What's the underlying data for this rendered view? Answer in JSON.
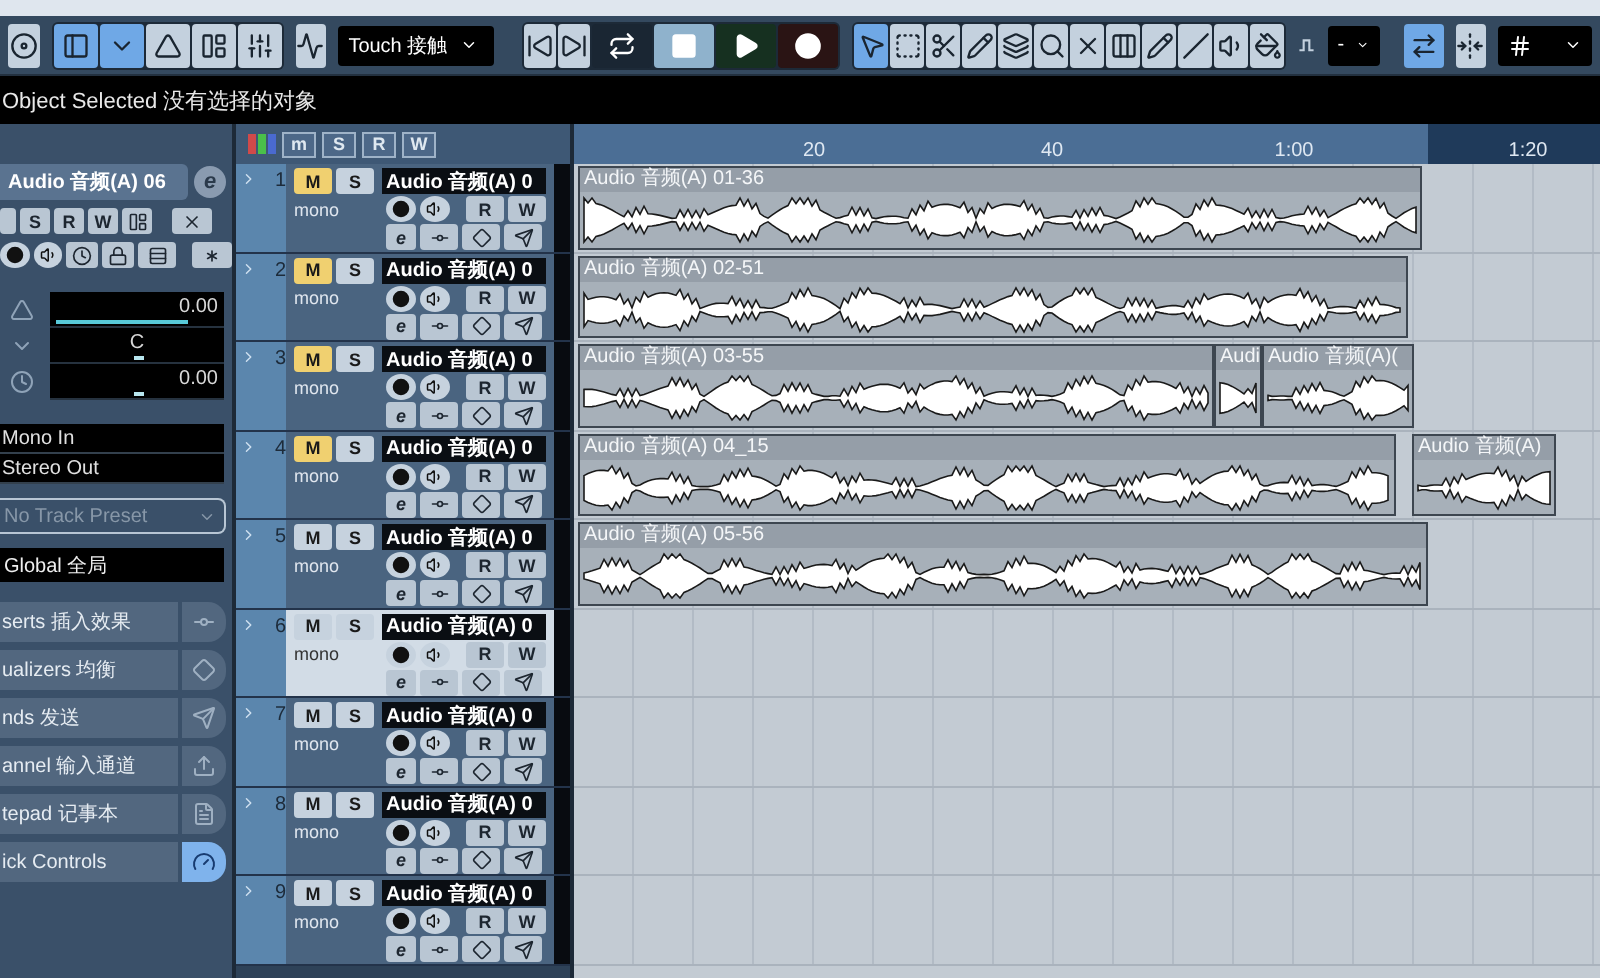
{
  "toolbar": {
    "activate": {
      "kind": "activate",
      "selected": false
    },
    "view_buttons": [
      {
        "kind": "inspector",
        "selected": true
      },
      {
        "kind": "info",
        "selected": true
      },
      {
        "kind": "overview",
        "selected": false
      },
      {
        "kind": "pool",
        "selected": false
      },
      {
        "kind": "mixer",
        "selected": false
      }
    ],
    "automation_mode": "Touch 接触",
    "transport": [
      {
        "kind": "prev"
      },
      {
        "kind": "next"
      },
      {
        "kind": "cycle"
      },
      {
        "kind": "stop"
      },
      {
        "kind": "play"
      },
      {
        "kind": "record"
      }
    ],
    "tools": [
      {
        "kind": "pointer",
        "selected": true
      },
      {
        "kind": "range",
        "selected": false
      },
      {
        "kind": "split",
        "selected": false
      },
      {
        "kind": "glue",
        "selected": false
      },
      {
        "kind": "erase",
        "selected": false
      },
      {
        "kind": "zoom",
        "selected": false
      },
      {
        "kind": "mute",
        "selected": false
      },
      {
        "kind": "comp",
        "selected": false
      },
      {
        "kind": "draw",
        "selected": false
      },
      {
        "kind": "line",
        "selected": false
      },
      {
        "kind": "play",
        "selected": false
      },
      {
        "kind": "color",
        "selected": false
      }
    ],
    "quantize_value": "-",
    "snap_on": true
  },
  "info_line": "Object Selected 没有选择的对象",
  "inspector": {
    "track_name": "Audio 音频(A) 06",
    "edit_label": "e",
    "buttons": [
      "S",
      "R",
      "W"
    ],
    "volume": {
      "reading": "0.00",
      "level": 0.82
    },
    "pan": {
      "reading": "C",
      "level": 0.5
    },
    "delay": {
      "reading": "0.00",
      "level": 0.5
    },
    "input": "Mono In",
    "output": "Stereo Out",
    "preset": "No Track Preset",
    "global": "Global 全局",
    "sections": [
      {
        "label": "serts 插入效果",
        "kind": "inserts",
        "on": false
      },
      {
        "label": "ualizers 均衡",
        "kind": "eq",
        "on": false
      },
      {
        "label": "nds 发送",
        "kind": "sends",
        "on": false
      },
      {
        "label": "annel 输入通道",
        "kind": "channel",
        "on": false
      },
      {
        "label": "tepad 记事本",
        "kind": "notepad",
        "on": false
      },
      {
        "label": "ick Controls",
        "kind": "quick",
        "on": true
      }
    ]
  },
  "track_list_header": [
    "m",
    "S",
    "R",
    "W"
  ],
  "ruler": [
    "20",
    "40",
    "1:00",
    "1:20"
  ],
  "tracks": [
    {
      "number": "1",
      "name": "Audio 音频(A) 0",
      "mode": "mono",
      "muted": true,
      "selected": false,
      "mute": "M",
      "solo": "S",
      "read": "R",
      "write": "W",
      "edit": "e",
      "clips": [
        {
          "label": "Audio 音频(A) 01-36"
        }
      ]
    },
    {
      "number": "2",
      "name": "Audio 音频(A) 0",
      "mode": "mono",
      "muted": true,
      "selected": false,
      "mute": "M",
      "solo": "S",
      "read": "R",
      "write": "W",
      "edit": "e",
      "clips": [
        {
          "label": "Audio 音频(A) 02-51"
        }
      ]
    },
    {
      "number": "3",
      "name": "Audio 音频(A) 0",
      "mode": "mono",
      "muted": true,
      "selected": false,
      "mute": "M",
      "solo": "S",
      "read": "R",
      "write": "W",
      "edit": "e",
      "clips": [
        {
          "label": "Audio 音频(A) 03-55"
        },
        {
          "label": "Audi"
        },
        {
          "label": "Audio 音频(A)("
        }
      ]
    },
    {
      "number": "4",
      "name": "Audio 音频(A) 0",
      "mode": "mono",
      "muted": true,
      "selected": false,
      "mute": "M",
      "solo": "S",
      "read": "R",
      "write": "W",
      "edit": "e",
      "clips": [
        {
          "label": "Audio 音频(A) 04_15"
        },
        {
          "label": "Audio 音频(A)"
        }
      ]
    },
    {
      "number": "5",
      "name": "Audio 音频(A) 0",
      "mode": "mono",
      "muted": false,
      "selected": false,
      "mute": "M",
      "solo": "S",
      "read": "R",
      "write": "W",
      "edit": "e",
      "clips": [
        {
          "label": "Audio 音频(A) 05-56"
        }
      ]
    },
    {
      "number": "6",
      "name": "Audio 音频(A) 0",
      "mode": "mono",
      "muted": false,
      "selected": true,
      "mute": "M",
      "solo": "S",
      "read": "R",
      "write": "W",
      "edit": "e"
    },
    {
      "number": "7",
      "name": "Audio 音频(A) 0",
      "mode": "mono",
      "muted": false,
      "selected": false,
      "mute": "M",
      "solo": "S",
      "read": "R",
      "write": "W",
      "edit": "e"
    },
    {
      "number": "8",
      "name": "Audio 音频(A) 0",
      "mode": "mono",
      "muted": false,
      "selected": false,
      "mute": "M",
      "solo": "S",
      "read": "R",
      "write": "W",
      "edit": "e"
    },
    {
      "number": "9",
      "name": "Audio 音频(A) 0",
      "mode": "mono",
      "muted": false,
      "selected": false,
      "mute": "M",
      "solo": "S",
      "read": "R",
      "write": "W",
      "edit": "e"
    }
  ]
}
